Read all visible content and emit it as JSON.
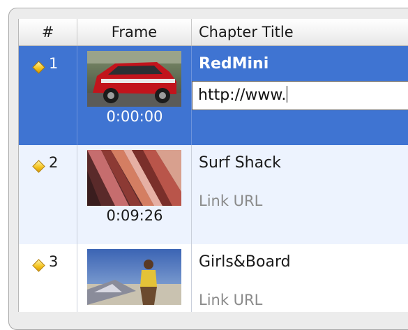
{
  "columns": {
    "num": "#",
    "frame": "Frame",
    "title": "Chapter Title"
  },
  "rows": [
    {
      "num": "1",
      "timecode": "0:00:00",
      "title": "RedMini",
      "url_value": "http://www.",
      "selected": true
    },
    {
      "num": "2",
      "timecode": "0:09:26",
      "title": "Surf Shack",
      "link_placeholder": "Link URL"
    },
    {
      "num": "3",
      "title": "Girls&Board",
      "link_placeholder": "Link URL"
    }
  ],
  "colors": {
    "selection": "#3f74d2",
    "alt_row": "#edf3fe",
    "diamond": "#f4c21c"
  },
  "icons": {
    "chapter_marker": "diamond-icon"
  }
}
